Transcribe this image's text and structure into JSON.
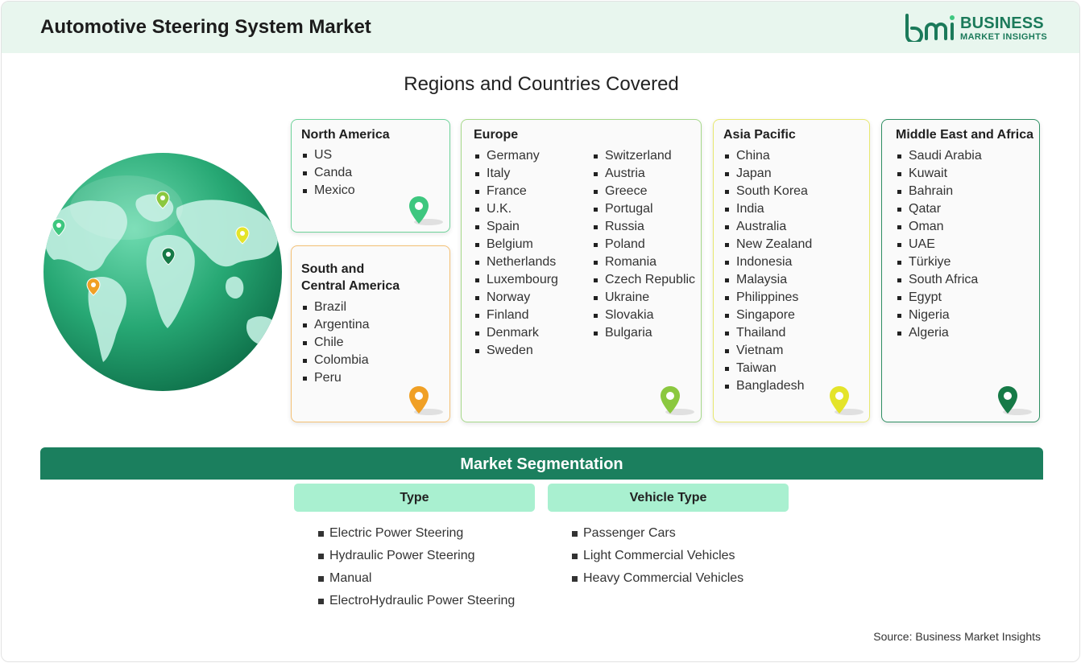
{
  "header": {
    "title": "Automotive Steering System Market"
  },
  "logo": {
    "line1": "BUSINESS",
    "line2": "MARKET INSIGHTS"
  },
  "regions_title": "Regions and Countries Covered",
  "regions": {
    "north_america": {
      "title": "North America",
      "color": "#6fd39a",
      "pin_color": "#3ec77f",
      "items": [
        "US",
        "Canda",
        "Mexico"
      ]
    },
    "south_america": {
      "title_line1": "South and",
      "title_line2": "Central America",
      "color": "#f4c074",
      "pin_color": "#f0a025",
      "items": [
        "Brazil",
        "Argentina",
        "Chile",
        "Colombia",
        "Peru"
      ]
    },
    "europe": {
      "title": "Europe",
      "color": "#a6d98a",
      "pin_color": "#8bc83f",
      "col1": [
        "Germany",
        "Italy",
        "France",
        "U.K.",
        "Spain",
        "Belgium",
        "Netherlands",
        "Luxembourg",
        "Norway",
        "Finland",
        "Denmark",
        "Sweden"
      ],
      "col2": [
        "Switzerland",
        "Austria",
        "Greece",
        "Portugal",
        "Russia",
        "Poland",
        "Romania",
        "Czech Republic",
        "Ukraine",
        "Slovakia",
        "Bulgaria"
      ]
    },
    "asia_pacific": {
      "title": "Asia Pacific",
      "color": "#e8e870",
      "pin_color": "#e4e42a",
      "items": [
        "China",
        "Japan",
        "South Korea",
        "India",
        "Australia",
        "New Zealand",
        "Indonesia",
        "Malaysia",
        "Philippines",
        "Singapore",
        "Thailand",
        "Vietnam",
        "Taiwan",
        "Bangladesh"
      ]
    },
    "mea": {
      "title": "Middle East and Africa",
      "color": "#2e8f63",
      "pin_color": "#167a47",
      "items": [
        "Saudi Arabia",
        "Kuwait",
        "Bahrain",
        "Qatar",
        "Oman",
        "UAE",
        "Türkiye",
        "South Africa",
        "Egypt",
        "Nigeria",
        "Algeria"
      ]
    }
  },
  "segmentation": {
    "title": "Market Segmentation",
    "type": {
      "label": "Type",
      "items": [
        "Electric Power Steering",
        "Hydraulic Power Steering",
        "Manual",
        "ElectroHydraulic Power Steering"
      ]
    },
    "vehicle_type": {
      "label": "Vehicle Type",
      "items": [
        "Passenger Cars",
        "Light Commercial Vehicles",
        "Heavy Commercial Vehicles"
      ]
    }
  },
  "source": "Source: Business Market Insights",
  "colors": {
    "header_bg": "#e8f6ee",
    "brand": "#1b7a5a",
    "seg_bar": "#1b7f5e",
    "seg_head": "#a9f0d0"
  }
}
